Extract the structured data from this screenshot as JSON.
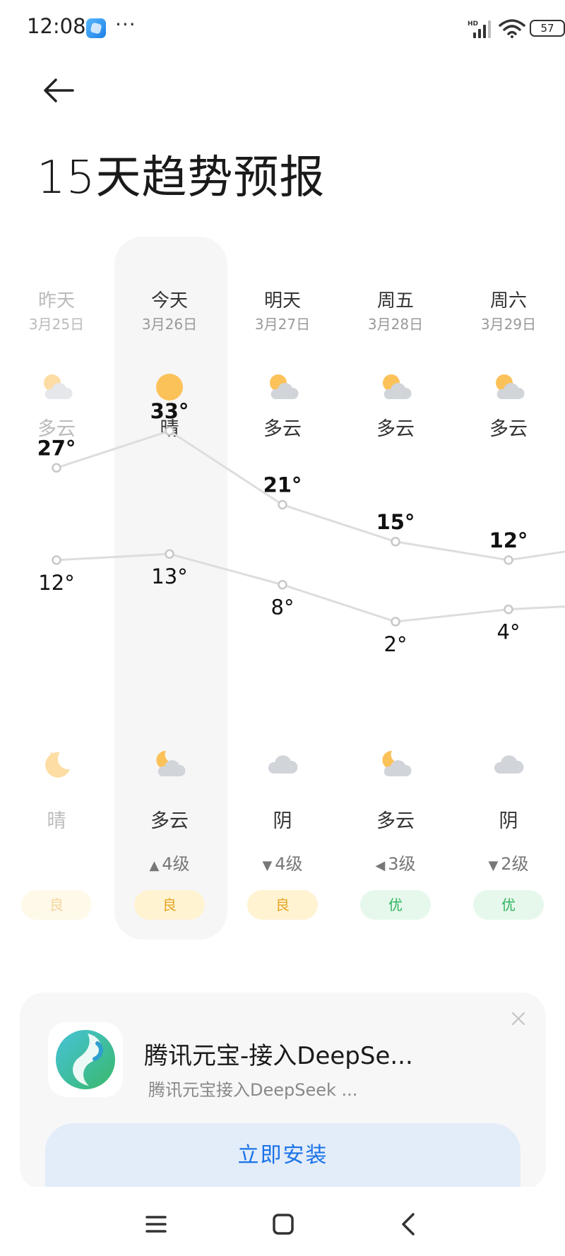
{
  "status_bar": {
    "time": "12:08",
    "more_dots": "···",
    "network_badge": "HD",
    "battery": "57"
  },
  "header": {
    "title": "15天趋势预报"
  },
  "forecast": {
    "days": [
      {
        "name": "昨天",
        "date": "3月25日",
        "day_condition": "多云",
        "day_icon": "partly-cloudy-day-icon",
        "high": "27°",
        "high_value": 27,
        "low": "12°",
        "low_value": 12,
        "night_condition": "晴",
        "night_icon": "moon-icon",
        "wind": "",
        "aqi": "良",
        "aqi_level": "good",
        "past": true
      },
      {
        "name": "今天",
        "date": "3月26日",
        "day_condition": "晴",
        "day_icon": "sun-icon",
        "high": "33°",
        "high_value": 33,
        "low": "13°",
        "low_value": 13,
        "night_condition": "多云",
        "night_icon": "partly-cloudy-night-icon",
        "wind": "4级",
        "wind_arrow": "▲",
        "aqi": "良",
        "aqi_level": "good",
        "past": false
      },
      {
        "name": "明天",
        "date": "3月27日",
        "day_condition": "多云",
        "day_icon": "partly-cloudy-day-icon",
        "high": "21°",
        "high_value": 21,
        "low": "8°",
        "low_value": 8,
        "night_condition": "阴",
        "night_icon": "cloud-icon",
        "wind": "4级",
        "wind_arrow": "▼",
        "aqi": "良",
        "aqi_level": "good",
        "past": false
      },
      {
        "name": "周五",
        "date": "3月28日",
        "day_condition": "多云",
        "day_icon": "partly-cloudy-day-icon",
        "high": "15°",
        "high_value": 15,
        "low": "2°",
        "low_value": 2,
        "night_condition": "多云",
        "night_icon": "partly-cloudy-night-icon",
        "wind": "3级",
        "wind_arrow": "◀",
        "aqi": "优",
        "aqi_level": "excellent",
        "past": false
      },
      {
        "name": "周六",
        "date": "3月29日",
        "day_condition": "多云",
        "day_icon": "partly-cloudy-day-icon",
        "high": "12°",
        "high_value": 12,
        "low": "4°",
        "low_value": 4,
        "night_condition": "阴",
        "night_icon": "cloud-icon",
        "wind": "2级",
        "wind_arrow": "▼",
        "aqi": "优",
        "aqi_level": "excellent",
        "past": false
      }
    ],
    "colors": {
      "highlight": "#f6f6f7",
      "line": "#dddddd",
      "aqi_good_bg": "#fff3d2",
      "aqi_good_text": "#e8a626",
      "aqi_excellent_bg": "#e6f8ec",
      "aqi_excellent_text": "#2fb35f",
      "sun": "#fcc25a",
      "cloud": "#d1d5da"
    }
  },
  "ad": {
    "app_icon": "tencent-yuanbao-icon",
    "title": "腾讯元宝-接入DeepSe...",
    "subtitle": "腾讯元宝接入DeepSeek ...",
    "install_label": "立即安装",
    "close_icon": "close-icon"
  },
  "nav_bar": {
    "menu_icon": "menu-icon",
    "home_icon": "home-icon",
    "back_icon": "back-icon"
  }
}
